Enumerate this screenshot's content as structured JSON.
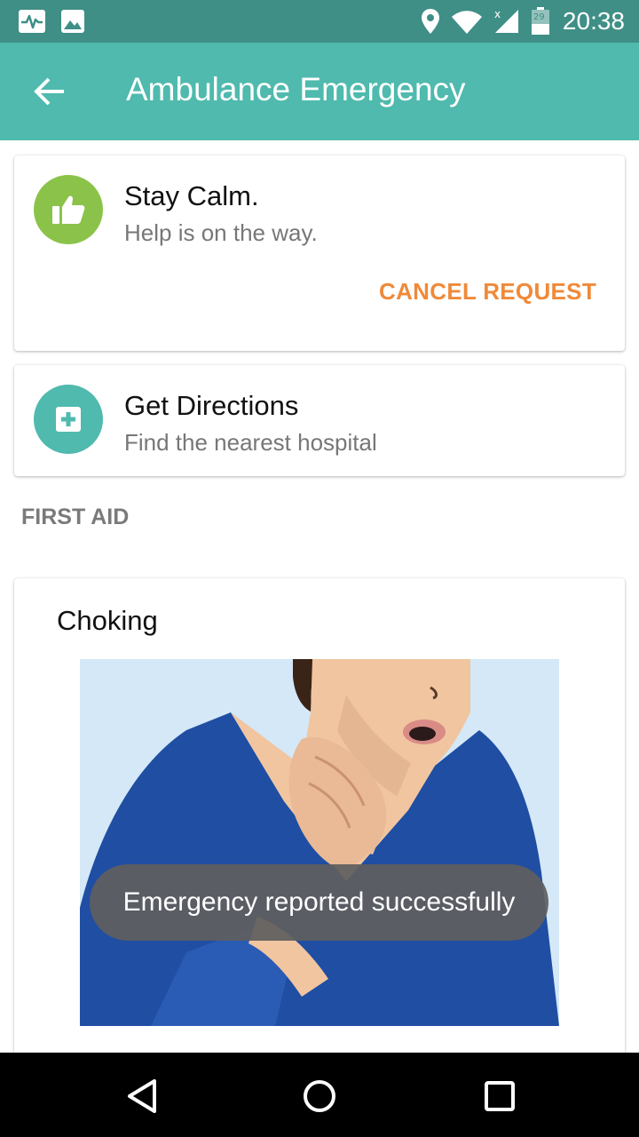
{
  "status_bar": {
    "time": "20:38",
    "battery_level": "29",
    "icons": [
      "activity-icon",
      "image-icon",
      "location-icon",
      "wifi-icon",
      "signal-icon",
      "battery-icon"
    ]
  },
  "app_bar": {
    "title": "Ambulance Emergency",
    "back_icon": "back-arrow-icon"
  },
  "calm_card": {
    "icon": "thumbs-up-icon",
    "title": "Stay Calm.",
    "subtitle": "Help is on the way.",
    "cancel_label": "CANCEL REQUEST"
  },
  "directions_card": {
    "icon": "hospital-plus-icon",
    "title": "Get Directions",
    "subtitle": "Find the nearest hospital"
  },
  "first_aid": {
    "section_label": "FIRST AID",
    "card_title": "Choking",
    "image": "choking-illustration"
  },
  "toast": {
    "message": "Emergency reported successfully"
  },
  "nav_bar": {
    "icons": [
      "back-triangle-icon",
      "home-circle-icon",
      "recents-square-icon"
    ]
  },
  "colors": {
    "status_bar": "#3f8f86",
    "app_bar": "#4fbaad",
    "calm_icon_bg": "#8bc34a",
    "directions_icon_bg": "#4fbaad",
    "cancel_accent": "#ef8a3a"
  }
}
